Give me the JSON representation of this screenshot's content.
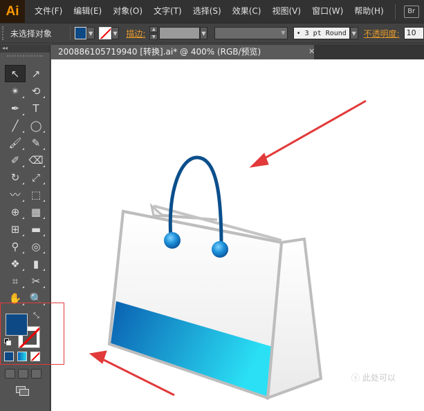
{
  "app": {
    "logo_text": "Ai",
    "bridge_label": "Br"
  },
  "menu": {
    "items": [
      "文件(F)",
      "编辑(E)",
      "对象(O)",
      "文字(T)",
      "选择(S)",
      "效果(C)",
      "视图(V)",
      "窗口(W)",
      "帮助(H)"
    ]
  },
  "control": {
    "selection_label": "未选择对象",
    "stroke_label": "描边:",
    "brush_label": "• 3 pt Round",
    "opacity_label": "不透明度:",
    "opacity_value": "10"
  },
  "document": {
    "tab_title": "200886105719940  [转换].ai* @ 400% (RGB/预览)",
    "close_glyph": "✕",
    "watermark": "ⓢ 此处可以"
  },
  "tools": {
    "items": [
      {
        "name": "selection-tool",
        "glyph": "↖"
      },
      {
        "name": "direct-selection-tool",
        "glyph": "↗"
      },
      {
        "name": "magic-wand-tool",
        "glyph": "✴"
      },
      {
        "name": "lasso-tool",
        "glyph": "⟲"
      },
      {
        "name": "pen-tool",
        "glyph": "✒"
      },
      {
        "name": "type-tool",
        "glyph": "T"
      },
      {
        "name": "line-segment-tool",
        "glyph": "╱"
      },
      {
        "name": "ellipse-tool",
        "glyph": "◯"
      },
      {
        "name": "paintbrush-tool",
        "glyph": "🖌"
      },
      {
        "name": "pencil-tool",
        "glyph": "✎"
      },
      {
        "name": "blob-brush-tool",
        "glyph": "✐"
      },
      {
        "name": "eraser-tool",
        "glyph": "⌫"
      },
      {
        "name": "rotate-tool",
        "glyph": "↻"
      },
      {
        "name": "scale-tool",
        "glyph": "⤢"
      },
      {
        "name": "warp-tool",
        "glyph": "〰"
      },
      {
        "name": "free-transform-tool",
        "glyph": "⬚"
      },
      {
        "name": "shape-builder-tool",
        "glyph": "⊕"
      },
      {
        "name": "perspective-grid-tool",
        "glyph": "▦"
      },
      {
        "name": "mesh-tool",
        "glyph": "⊞"
      },
      {
        "name": "gradient-tool",
        "glyph": "▬"
      },
      {
        "name": "eyedropper-tool",
        "glyph": "⚲"
      },
      {
        "name": "blend-tool",
        "glyph": "◎"
      },
      {
        "name": "symbol-sprayer-tool",
        "glyph": "❖"
      },
      {
        "name": "column-graph-tool",
        "glyph": "▮"
      },
      {
        "name": "artboard-tool",
        "glyph": "⌗"
      },
      {
        "name": "slice-tool",
        "glyph": "✂"
      },
      {
        "name": "hand-tool",
        "glyph": "✋"
      },
      {
        "name": "zoom-tool",
        "glyph": "🔍"
      }
    ]
  },
  "colors": {
    "fill": "#0d4a85",
    "gradient_start": "#0a66b8",
    "gradient_end": "#27d9f0",
    "annotation_red": "#e23a3a"
  }
}
